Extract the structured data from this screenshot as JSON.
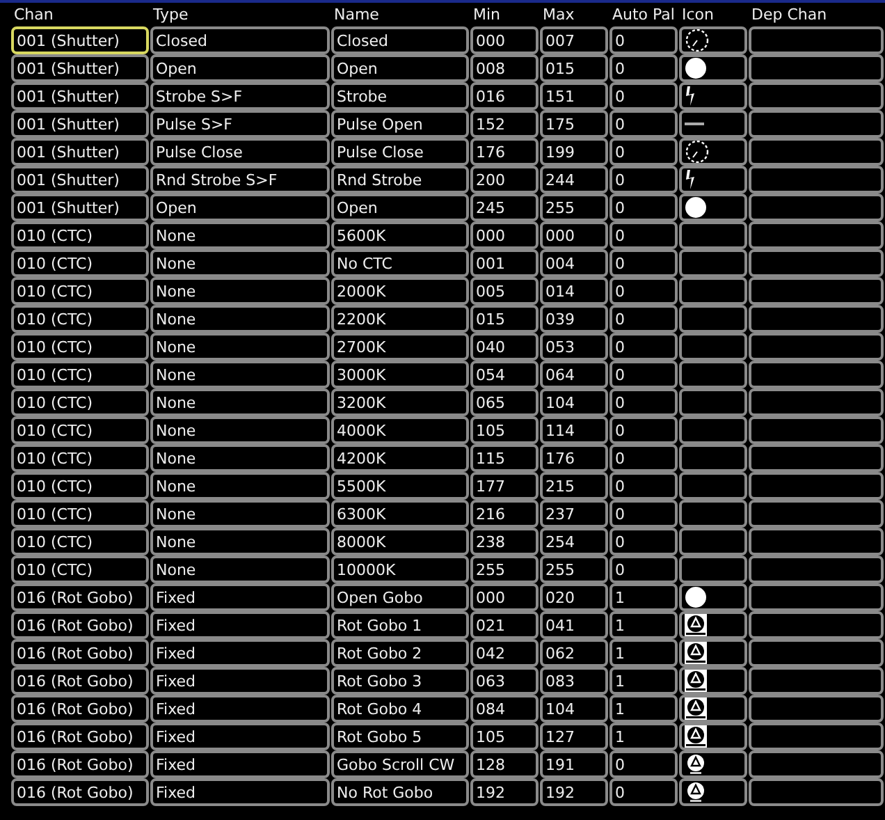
{
  "columns": [
    "Chan",
    "Type",
    "Name",
    "Min",
    "Max",
    "Auto Pal",
    "Icon",
    "Dep Chan"
  ],
  "rows": [
    {
      "chan": "001 (Shutter)",
      "type": "Closed",
      "name": "Closed",
      "min": "000",
      "max": "007",
      "auto_pal": "0",
      "kind": "dotted-circle",
      "selected": true
    },
    {
      "chan": "001 (Shutter)",
      "type": "Open",
      "name": "Open",
      "min": "008",
      "max": "015",
      "auto_pal": "0",
      "kind": "disc",
      "selected": false
    },
    {
      "chan": "001 (Shutter)",
      "type": "Strobe S>F",
      "name": "Strobe",
      "min": "016",
      "max": "151",
      "auto_pal": "0",
      "kind": "bolt",
      "selected": false
    },
    {
      "chan": "001 (Shutter)",
      "type": "Pulse S>F",
      "name": "Pulse Open",
      "min": "152",
      "max": "175",
      "auto_pal": "0",
      "kind": "mark",
      "selected": false
    },
    {
      "chan": "001 (Shutter)",
      "type": "Pulse Close",
      "name": "Pulse Close",
      "min": "176",
      "max": "199",
      "auto_pal": "0",
      "kind": "dotted-circle",
      "selected": false
    },
    {
      "chan": "001 (Shutter)",
      "type": "Rnd Strobe S>F",
      "name": "Rnd Strobe",
      "min": "200",
      "max": "244",
      "auto_pal": "0",
      "kind": "bolt",
      "selected": false
    },
    {
      "chan": "001 (Shutter)",
      "type": "Open",
      "name": "Open",
      "min": "245",
      "max": "255",
      "auto_pal": "0",
      "kind": "disc",
      "selected": false
    },
    {
      "chan": "010 (CTC)",
      "type": "None",
      "name": "5600K",
      "min": "000",
      "max": "000",
      "auto_pal": "0",
      "selected": false
    },
    {
      "chan": "010 (CTC)",
      "type": "None",
      "name": "No CTC",
      "min": "001",
      "max": "004",
      "auto_pal": "0",
      "selected": false
    },
    {
      "chan": "010 (CTC)",
      "type": "None",
      "name": "2000K",
      "min": "005",
      "max": "014",
      "auto_pal": "0",
      "selected": false
    },
    {
      "chan": "010 (CTC)",
      "type": "None",
      "name": "2200K",
      "min": "015",
      "max": "039",
      "auto_pal": "0",
      "selected": false
    },
    {
      "chan": "010 (CTC)",
      "type": "None",
      "name": "2700K",
      "min": "040",
      "max": "053",
      "auto_pal": "0",
      "selected": false
    },
    {
      "chan": "010 (CTC)",
      "type": "None",
      "name": "3000K",
      "min": "054",
      "max": "064",
      "auto_pal": "0",
      "selected": false
    },
    {
      "chan": "010 (CTC)",
      "type": "None",
      "name": "3200K",
      "min": "065",
      "max": "104",
      "auto_pal": "0",
      "selected": false
    },
    {
      "chan": "010 (CTC)",
      "type": "None",
      "name": "4000K",
      "min": "105",
      "max": "114",
      "auto_pal": "0",
      "selected": false
    },
    {
      "chan": "010 (CTC)",
      "type": "None",
      "name": "4200K",
      "min": "115",
      "max": "176",
      "auto_pal": "0",
      "selected": false
    },
    {
      "chan": "010 (CTC)",
      "type": "None",
      "name": "5500K",
      "min": "177",
      "max": "215",
      "auto_pal": "0",
      "selected": false
    },
    {
      "chan": "010 (CTC)",
      "type": "None",
      "name": "6300K",
      "min": "216",
      "max": "237",
      "auto_pal": "0",
      "selected": false
    },
    {
      "chan": "010 (CTC)",
      "type": "None",
      "name": "8000K",
      "min": "238",
      "max": "254",
      "auto_pal": "0",
      "selected": false
    },
    {
      "chan": "010 (CTC)",
      "type": "None",
      "name": "10000K",
      "min": "255",
      "max": "255",
      "auto_pal": "0",
      "selected": false
    },
    {
      "chan": "016 (Rot Gobo)",
      "type": "Fixed",
      "name": "Open Gobo",
      "min": "000",
      "max": "020",
      "auto_pal": "1",
      "kind": "disc",
      "selected": false
    },
    {
      "chan": "016 (Rot Gobo)",
      "type": "Fixed",
      "name": "Rot Gobo 1",
      "min": "021",
      "max": "041",
      "auto_pal": "1",
      "kind": "gobo",
      "selected": false
    },
    {
      "chan": "016 (Rot Gobo)",
      "type": "Fixed",
      "name": "Rot Gobo 2",
      "min": "042",
      "max": "062",
      "auto_pal": "1",
      "kind": "gobo",
      "selected": false
    },
    {
      "chan": "016 (Rot Gobo)",
      "type": "Fixed",
      "name": "Rot Gobo 3",
      "min": "063",
      "max": "083",
      "auto_pal": "1",
      "kind": "gobo",
      "selected": false
    },
    {
      "chan": "016 (Rot Gobo)",
      "type": "Fixed",
      "name": "Rot Gobo 4",
      "min": "084",
      "max": "104",
      "auto_pal": "1",
      "kind": "gobo",
      "selected": false
    },
    {
      "chan": "016 (Rot Gobo)",
      "type": "Fixed",
      "name": "Rot Gobo 5",
      "min": "105",
      "max": "127",
      "auto_pal": "1",
      "kind": "gobo",
      "selected": false
    },
    {
      "chan": "016 (Rot Gobo)",
      "type": "Fixed",
      "name": "Gobo Scroll CW",
      "min": "128",
      "max": "191",
      "auto_pal": "0",
      "kind": "outline",
      "selected": false
    },
    {
      "chan": "016 (Rot Gobo)",
      "type": "Fixed",
      "name": "No Rot Gobo",
      "min": "192",
      "max": "192",
      "auto_pal": "0",
      "kind": "outline",
      "selected": false
    }
  ]
}
